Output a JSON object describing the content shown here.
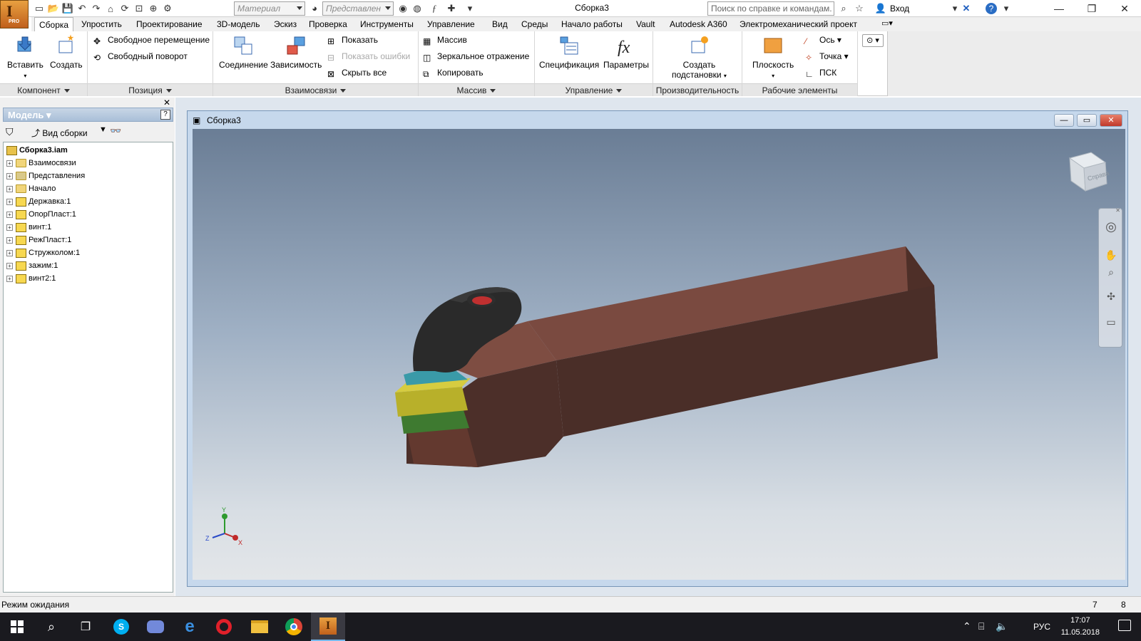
{
  "titlebar": {
    "doc_title": "Сборка3",
    "material_placeholder": "Материал",
    "view_rep_placeholder": "Представлен",
    "help_search_placeholder": "Поиск по справке и командам.",
    "login_label": "Вход",
    "app_badge": "PRO"
  },
  "tabs": [
    {
      "label": "Сборка",
      "active": true
    },
    {
      "label": "Упростить"
    },
    {
      "label": "Проектирование"
    },
    {
      "label": "3D-модель"
    },
    {
      "label": "Эскиз"
    },
    {
      "label": "Проверка"
    },
    {
      "label": "Инструменты"
    },
    {
      "label": "Управление"
    },
    {
      "label": "Вид"
    },
    {
      "label": "Среды"
    },
    {
      "label": "Начало работы"
    },
    {
      "label": "Vault"
    },
    {
      "label": "Autodesk A360"
    },
    {
      "label": "Электромеханический проект"
    }
  ],
  "ribbon": {
    "component": {
      "title": "Компонент",
      "insert": "Вставить",
      "create": "Создать"
    },
    "position": {
      "title": "Позиция",
      "free_move": "Свободное перемещение",
      "free_rotate": "Свободный поворот"
    },
    "relationships": {
      "title": "Взаимосвязи",
      "joint": "Соединение",
      "constrain": "Зависимость",
      "show": "Показать",
      "show_errors": "Показать ошибки",
      "hide_all": "Скрыть все"
    },
    "pattern": {
      "title": "Массив",
      "array": "Массив",
      "mirror": "Зеркальное отражение",
      "copy": "Копировать"
    },
    "manage": {
      "title": "Управление",
      "bom": "Спецификация",
      "parameters": "Параметры"
    },
    "productivity": {
      "title": "Производительность",
      "create_sub_line1": "Создать",
      "create_sub_line2": "подстановки"
    },
    "work_features": {
      "title": "Рабочие элементы",
      "plane": "Плоскость",
      "axis": "Ось",
      "point": "Точка",
      "ucs": "ПСК"
    }
  },
  "browser": {
    "title": "Модель",
    "view_label": "Вид сборки",
    "root": "Сборка3.iam",
    "items": [
      {
        "label": "Взаимосвязи",
        "type": "folder"
      },
      {
        "label": "Представления",
        "type": "views"
      },
      {
        "label": "Начало",
        "type": "folder"
      },
      {
        "label": "Державка:1",
        "type": "part"
      },
      {
        "label": "ОпорПласт:1",
        "type": "part"
      },
      {
        "label": "винт:1",
        "type": "part"
      },
      {
        "label": "РежПласт:1",
        "type": "part"
      },
      {
        "label": "Стружколом:1",
        "type": "part"
      },
      {
        "label": "зажим:1",
        "type": "part"
      },
      {
        "label": "винт2:1",
        "type": "part"
      }
    ]
  },
  "viewport": {
    "window_title": "Сборка3",
    "viewcube_label": "Справа",
    "triad": {
      "x": "X",
      "y": "Y",
      "z": "Z"
    }
  },
  "statusbar": {
    "text": "Режим ожидания",
    "count1": "7",
    "count2": "8"
  },
  "taskbar": {
    "lang": "РУС",
    "time": "17:07",
    "date": "11.05.2018"
  },
  "colors": {
    "holder": "#6e4238",
    "clamp": "#2a2a2a",
    "chipbreaker": "#3a9aa8",
    "insert": "#b8b02a",
    "shim": "#3e7a30"
  },
  "icons": [
    "app-menu-icon",
    "new-icon",
    "open-icon",
    "save-icon",
    "undo-icon",
    "redo-icon",
    "home-icon",
    "search-icon",
    "star-icon",
    "user-icon",
    "help-icon",
    "filter-icon",
    "binoculars-icon",
    "orbit-icon",
    "pan-icon",
    "zoom-icon",
    "windows-icon",
    "skype-icon",
    "discord-icon",
    "edge-icon",
    "opera-icon",
    "explorer-icon",
    "chrome-icon",
    "inventor-icon"
  ]
}
